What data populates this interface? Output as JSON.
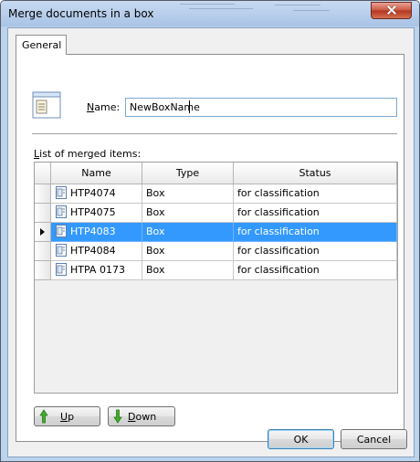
{
  "window": {
    "title": "Merge documents in a box"
  },
  "tabs": {
    "general": "General"
  },
  "name_field": {
    "label_accel": "N",
    "label_rest": "ame:",
    "value": "NewBoxName"
  },
  "list": {
    "label_accel": "L",
    "label_rest": "ist of merged items:",
    "columns": [
      "Name",
      "Type",
      "Status"
    ],
    "rows": [
      {
        "name": "HTP4074",
        "type": "Box",
        "status": "for classification",
        "selected": false
      },
      {
        "name": "HTP4075",
        "type": "Box",
        "status": "for classification",
        "selected": false
      },
      {
        "name": "HTP4083",
        "type": "Box",
        "status": "for classification",
        "selected": true
      },
      {
        "name": "HTP4084",
        "type": "Box",
        "status": "for classification",
        "selected": false
      },
      {
        "name": "HTPA 0173",
        "type": "Box",
        "status": "for classification",
        "selected": false
      }
    ]
  },
  "buttons": {
    "up": {
      "accel": "U",
      "rest": "p",
      "icon": "arrow-up-icon"
    },
    "down": {
      "accel": "D",
      "rest": "own",
      "icon": "arrow-down-icon"
    },
    "ok": "OK",
    "cancel": "Cancel"
  },
  "colors": {
    "selection": "#3399ff",
    "title_bar": "#bcd3ee",
    "close_button": "#c8553f",
    "arrow_green": "#3fae28"
  }
}
